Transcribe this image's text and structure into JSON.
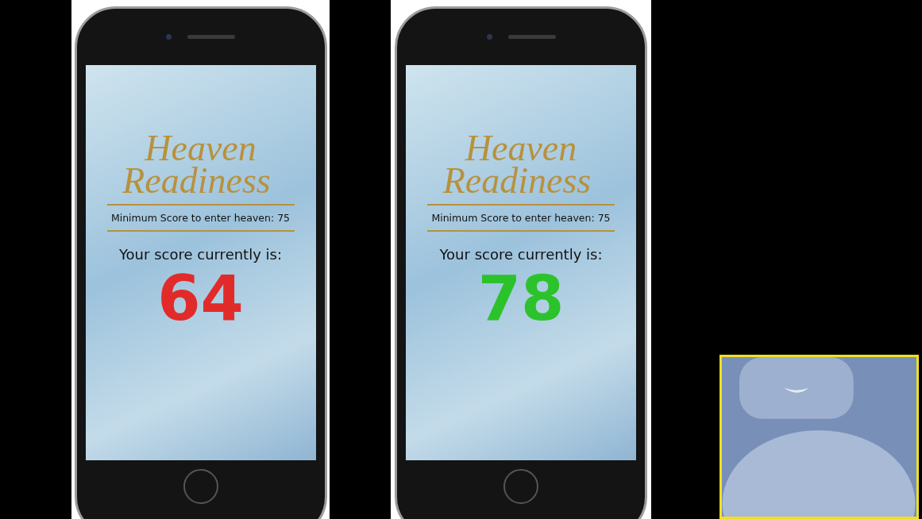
{
  "phones": [
    {
      "logo_line_1": "Heaven",
      "logo_line_2": "Readiness",
      "minimum_text": "Minimum Score to enter heaven: 75",
      "score_label": "Your score currently is:",
      "score": "64",
      "color": "#e12b2b"
    },
    {
      "logo_line_1": "Heaven",
      "logo_line_2": "Readiness",
      "minimum_text": "Minimum Score to enter heaven: 75",
      "score_label": "Your score currently is:",
      "score": "78",
      "color": "#2cc22c"
    }
  ],
  "participant_video": {
    "active_speaker": true
  }
}
